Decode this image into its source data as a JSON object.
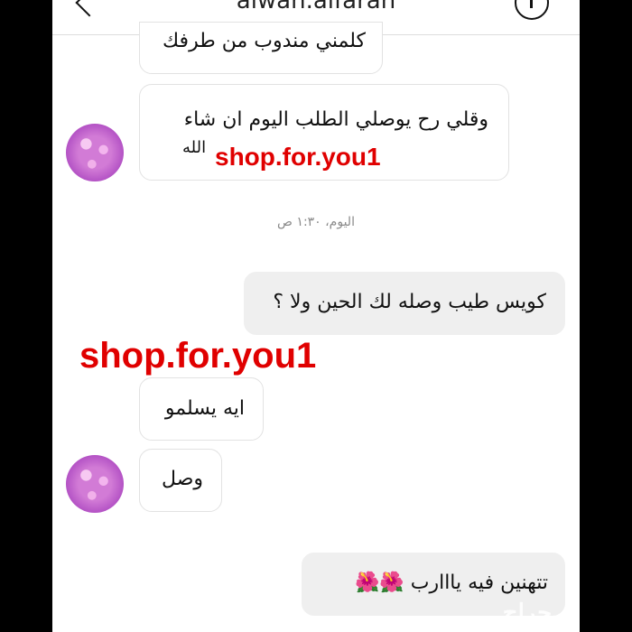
{
  "header": {
    "title": "alwan.alfaran"
  },
  "messages": {
    "m1": "كلمني مندوب من طرفك",
    "m2_line1": "وقلي رح يوصلي الطلب اليوم ان شاء",
    "m2_line2": "الله",
    "timestamp": "اليوم، ١:٣٠ ص",
    "m3": "كويس طيب وصله لك الحين ولا ؟",
    "m4": "ايه يسلمو",
    "m5": "وصل",
    "m6_text": "تتهنين فيه يااارب",
    "m6_emoji": "🌺🌺"
  },
  "watermarks": {
    "wm1": "shop.for.you1",
    "wm2": "shop.for.you1"
  },
  "logo": {
    "text": "حراج"
  }
}
